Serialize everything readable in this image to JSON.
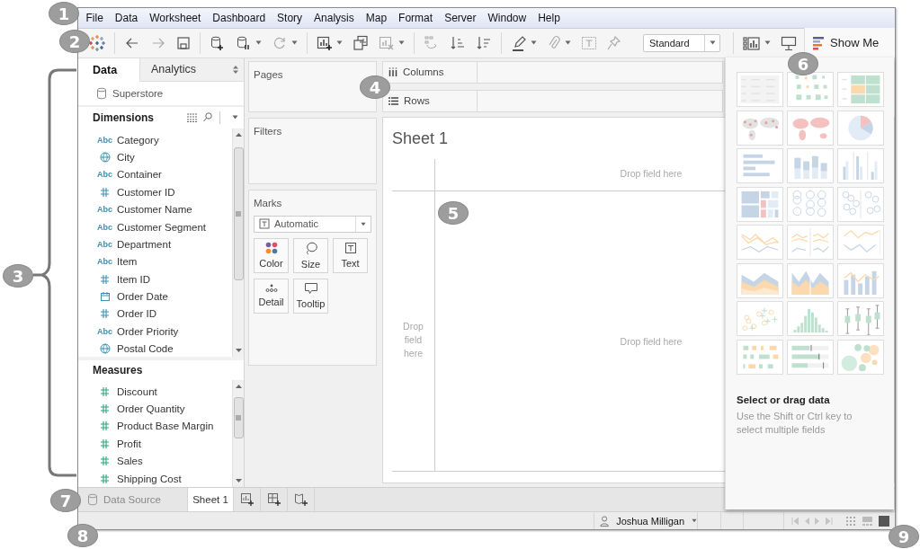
{
  "callouts": [
    {
      "label": "1"
    },
    {
      "label": "2"
    },
    {
      "label": "3"
    },
    {
      "label": "4"
    },
    {
      "label": "5"
    },
    {
      "label": "6"
    },
    {
      "label": "7"
    },
    {
      "label": "8"
    },
    {
      "label": "9"
    }
  ],
  "menu": [
    "File",
    "Data",
    "Worksheet",
    "Dashboard",
    "Story",
    "Analysis",
    "Map",
    "Format",
    "Server",
    "Window",
    "Help"
  ],
  "toolbar": {
    "fit": "Standard",
    "show_me": "Show Me"
  },
  "data_pane": {
    "tabs": [
      {
        "label": "Data",
        "selected": true
      },
      {
        "label": "Analytics",
        "selected": false
      }
    ],
    "data_source": "Superstore",
    "dimensions": {
      "title": "Dimensions",
      "fields": [
        {
          "name": "Category",
          "kind": "string",
          "badge": "Abc"
        },
        {
          "name": "City",
          "kind": "geo"
        },
        {
          "name": "Container",
          "kind": "string",
          "badge": "Abc"
        },
        {
          "name": "Customer ID",
          "kind": "number"
        },
        {
          "name": "Customer Name",
          "kind": "string",
          "badge": "Abc"
        },
        {
          "name": "Customer Segment",
          "kind": "string",
          "badge": "Abc"
        },
        {
          "name": "Department",
          "kind": "string",
          "badge": "Abc"
        },
        {
          "name": "Item",
          "kind": "string",
          "badge": "Abc"
        },
        {
          "name": "Item ID",
          "kind": "number"
        },
        {
          "name": "Order Date",
          "kind": "date"
        },
        {
          "name": "Order ID",
          "kind": "number"
        },
        {
          "name": "Order Priority",
          "kind": "string",
          "badge": "Abc"
        },
        {
          "name": "Postal Code",
          "kind": "geo"
        }
      ]
    },
    "measures": {
      "title": "Measures",
      "fields": [
        {
          "name": "Discount",
          "kind": "number"
        },
        {
          "name": "Order Quantity",
          "kind": "number"
        },
        {
          "name": "Product Base Margin",
          "kind": "number"
        },
        {
          "name": "Profit",
          "kind": "number"
        },
        {
          "name": "Sales",
          "kind": "number"
        },
        {
          "name": "Shipping Cost",
          "kind": "number"
        }
      ]
    }
  },
  "shelves": {
    "pages": "Pages",
    "filters": "Filters",
    "columns": "Columns",
    "rows": "Rows"
  },
  "marks": {
    "title": "Marks",
    "type": "Automatic",
    "cards": [
      {
        "label": "Color",
        "kind": "color"
      },
      {
        "label": "Size",
        "kind": "size"
      },
      {
        "label": "Text",
        "kind": "text"
      },
      {
        "label": "Detail",
        "kind": "detail"
      },
      {
        "label": "Tooltip",
        "kind": "tooltip"
      }
    ]
  },
  "sheet": {
    "title": "Sheet 1",
    "column_hint": "Drop field here",
    "row_hint": "Drop field here",
    "body_hint": "Drop field here"
  },
  "show_me": {
    "title": "Select or drag data",
    "hint": "Use the Shift or Ctrl key to select multiple fields"
  },
  "sheet_tabs": [
    {
      "label": "Data Source",
      "kind": "source",
      "selected": false
    },
    {
      "label": "Sheet 1",
      "kind": "sheet",
      "selected": true
    }
  ],
  "status": {
    "user": "Joshua Milligan"
  }
}
